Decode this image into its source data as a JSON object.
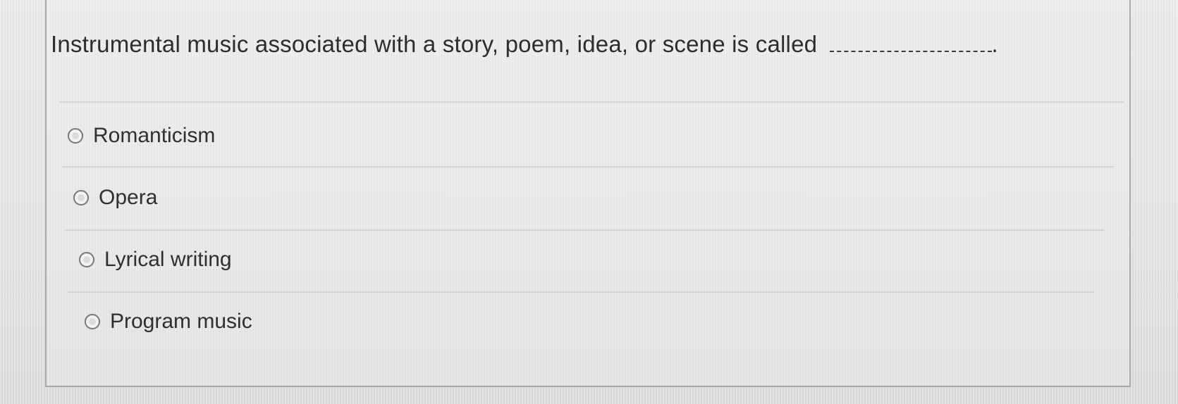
{
  "question": {
    "text": "Instrumental music associated with a story, poem, idea, or scene is called",
    "blank_suffix": "."
  },
  "options": [
    {
      "label": "Romanticism"
    },
    {
      "label": "Opera"
    },
    {
      "label": "Lyrical writing"
    },
    {
      "label": "Program music"
    }
  ],
  "colors": {
    "background": "#e6e7e6",
    "text": "#2d2d2d",
    "card_border": "#a9abaa",
    "divider": "#d3d4d3"
  }
}
